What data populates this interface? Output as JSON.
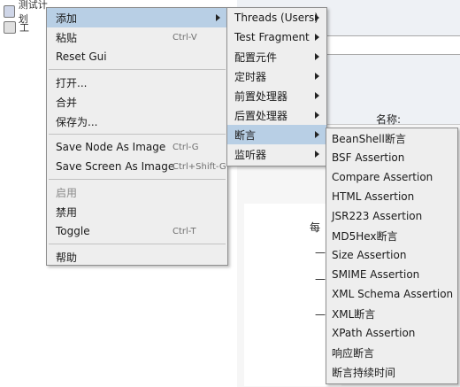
{
  "tree": {
    "items": [
      {
        "label": "测试计划"
      },
      {
        "label": "工"
      }
    ]
  },
  "background": {
    "name_label": "名称:",
    "glyphs": [
      "每",
      "—",
      "—",
      "—"
    ]
  },
  "main_menu": {
    "items": [
      {
        "label": "添加",
        "submenu": true,
        "selected": true
      },
      {
        "label": "粘贴",
        "shortcut": "Ctrl-V"
      },
      {
        "label": "Reset Gui"
      },
      {
        "separator": true
      },
      {
        "label": "打开..."
      },
      {
        "label": "合并"
      },
      {
        "label": "保存为..."
      },
      {
        "separator": true
      },
      {
        "label": "Save Node As Image",
        "shortcut": "Ctrl-G"
      },
      {
        "label": "Save Screen As Image",
        "shortcut": "Ctrl+Shift-G"
      },
      {
        "separator": true
      },
      {
        "label": "启用",
        "disabled": true
      },
      {
        "label": "禁用"
      },
      {
        "label": "Toggle",
        "shortcut": "Ctrl-T"
      },
      {
        "separator": true
      },
      {
        "label": "帮助"
      }
    ]
  },
  "add_menu": {
    "items": [
      {
        "label": "Threads (Users)",
        "submenu": true
      },
      {
        "label": "Test Fragment",
        "submenu": true
      },
      {
        "label": "配置元件",
        "submenu": true
      },
      {
        "label": "定时器",
        "submenu": true
      },
      {
        "label": "前置处理器",
        "submenu": true
      },
      {
        "label": "后置处理器",
        "submenu": true
      },
      {
        "label": "断言",
        "submenu": true,
        "selected": true
      },
      {
        "label": "监听器",
        "submenu": true
      }
    ]
  },
  "assertion_menu": {
    "items": [
      {
        "label": "BeanShell断言"
      },
      {
        "label": "BSF Assertion"
      },
      {
        "label": "Compare Assertion"
      },
      {
        "label": "HTML Assertion"
      },
      {
        "label": "JSR223 Assertion"
      },
      {
        "label": "MD5Hex断言"
      },
      {
        "label": "Size Assertion"
      },
      {
        "label": "SMIME Assertion"
      },
      {
        "label": "XML Schema Assertion"
      },
      {
        "label": "XML断言"
      },
      {
        "label": "XPath Assertion"
      },
      {
        "label": "响应断言"
      },
      {
        "label": "断言持续时间"
      }
    ]
  },
  "colors": {
    "menu_bg": "#eeeeee",
    "selected_bg": "#b8cfe5",
    "disabled_text": "#8a8a8a"
  }
}
